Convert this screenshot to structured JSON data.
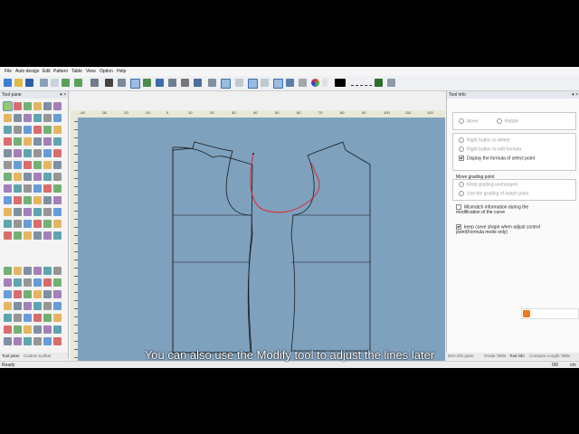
{
  "menu": [
    "File",
    "Auto design",
    "Edit",
    "Pattern",
    "Table",
    "View",
    "Option",
    "Help"
  ],
  "tool_pane": {
    "title": "Tool pane",
    "pin": "▾ ×"
  },
  "tool_info": {
    "title": "Tool info",
    "pin": "▾ ×",
    "group1": {
      "move": "Move",
      "rotate": "Rotate"
    },
    "group2": {
      "opt1": "Right button to delete",
      "opt2": "Right button to edit formula",
      "opt3": "Display the formula of select point"
    },
    "group3": {
      "title": "Move grading point",
      "opt1": "Keep grading unchanged",
      "opt2": "Use the grading of match point"
    },
    "mismatch": "Mismatch information during the modification of the curve",
    "keep_curve": "keep curve shape when adjust control point(Formula mode only)"
  },
  "bottom_tabs_left": [
    "Tool pane",
    "Custom toolbar"
  ],
  "bottom_tabs_right": [
    "Item info pane",
    "Grade Table",
    "Tool info",
    "Compare Length Table"
  ],
  "status": {
    "left": "Ready",
    "right": "0/0",
    "unit": "cm"
  },
  "ruler_top": [
    "-40",
    "-30",
    "-20",
    "-10",
    "0",
    "10",
    "20",
    "30",
    "40",
    "50",
    "60",
    "70",
    "80",
    "90",
    "100",
    "110",
    "120"
  ],
  "caption": "You can also use the Modify tool to adjust the lines later",
  "colors": {
    "canvas": "#7ea1be",
    "pattern_line": "#1a1a1a",
    "selected_curve": "#e0282e",
    "accent": "#2b6cb0"
  }
}
